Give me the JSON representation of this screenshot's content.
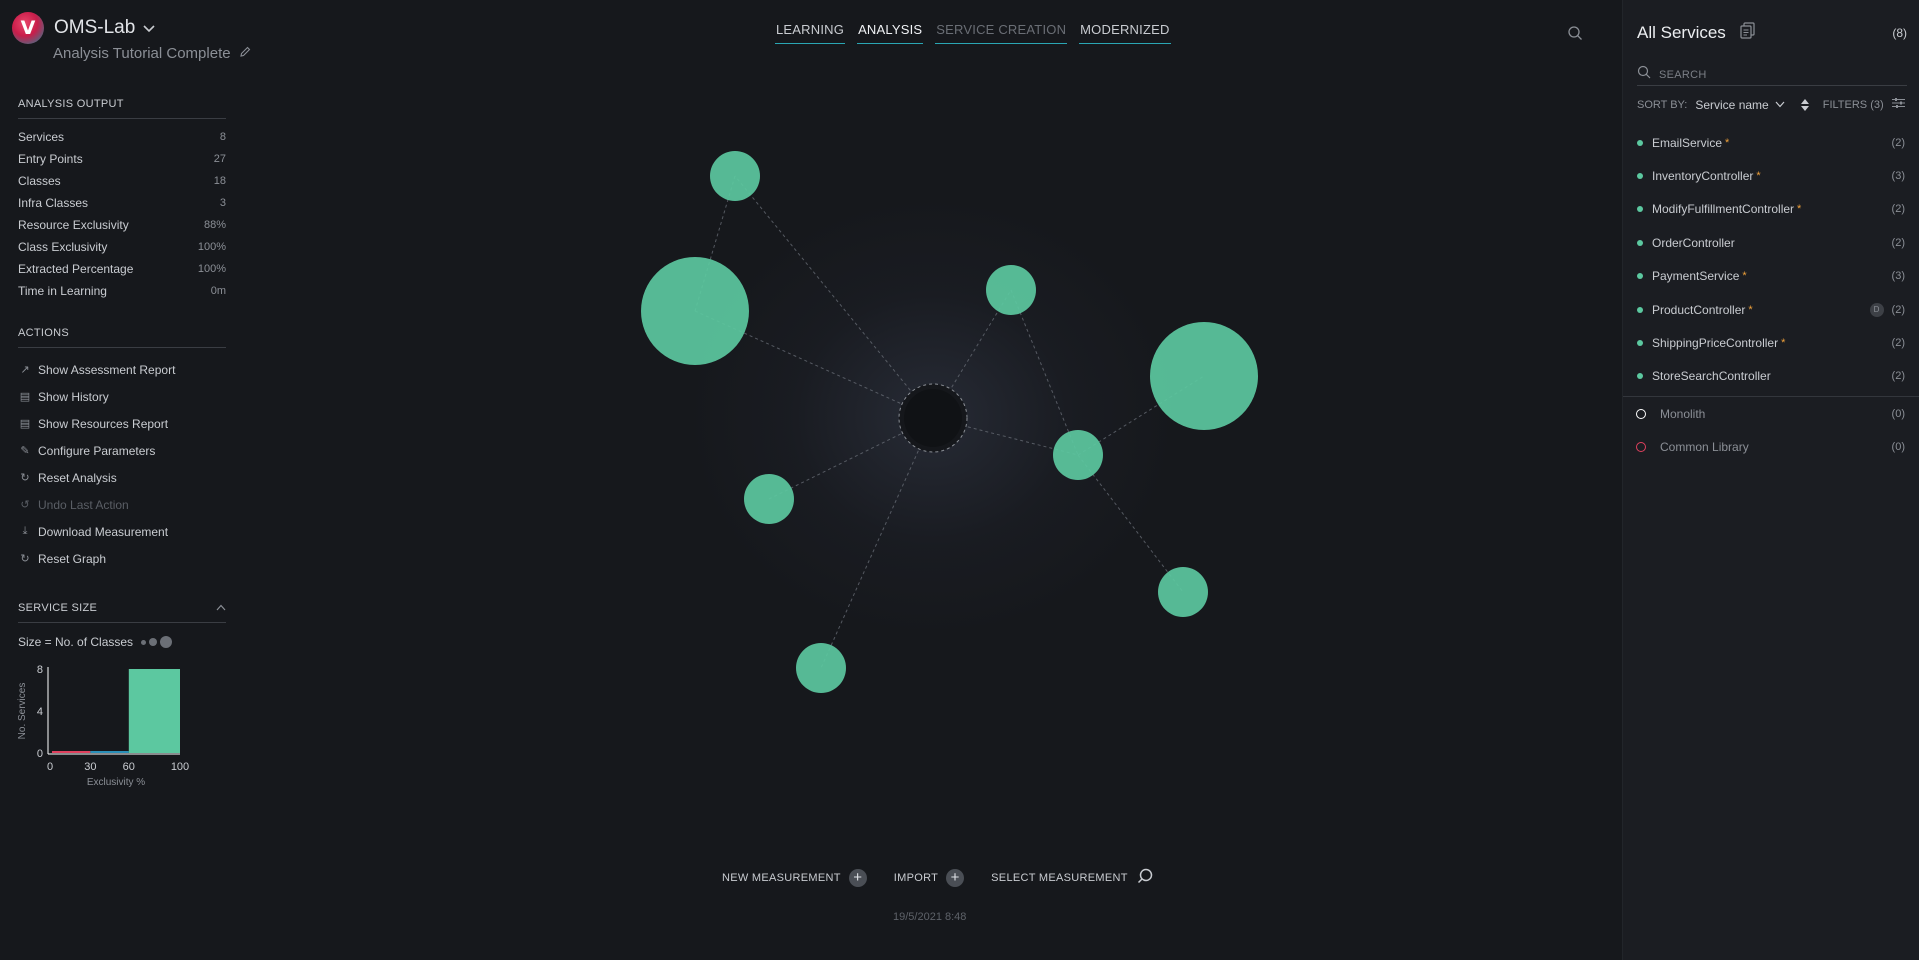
{
  "app": {
    "name": "OMS-Lab",
    "subtitle": "Analysis Tutorial Complete",
    "logo_letter": "V"
  },
  "nav": {
    "tabs": [
      {
        "label": "LEARNING",
        "state": "normal"
      },
      {
        "label": "ANALYSIS",
        "state": "active"
      },
      {
        "label": "SERVICE CREATION",
        "state": "dim"
      },
      {
        "label": "MODERNIZED",
        "state": "normal"
      }
    ]
  },
  "analysis_output": {
    "title": "ANALYSIS OUTPUT",
    "rows": [
      {
        "label": "Services",
        "value": "8"
      },
      {
        "label": "Entry Points",
        "value": "27"
      },
      {
        "label": "Classes",
        "value": "18"
      },
      {
        "label": "Infra Classes",
        "value": "3"
      },
      {
        "label": "Resource Exclusivity",
        "value": "88%"
      },
      {
        "label": "Class Exclusivity",
        "value": "100%"
      },
      {
        "label": "Extracted Percentage",
        "value": "100%"
      },
      {
        "label": "Time in Learning",
        "value": "0m"
      }
    ]
  },
  "actions": {
    "title": "ACTIONS",
    "items": [
      {
        "label": "Show Assessment Report",
        "icon": "external-link-icon",
        "glyph": "↗",
        "enabled": true
      },
      {
        "label": "Show History",
        "icon": "document-icon",
        "glyph": "▤",
        "enabled": true
      },
      {
        "label": "Show Resources Report",
        "icon": "document-icon",
        "glyph": "▤",
        "enabled": true
      },
      {
        "label": "Configure Parameters",
        "icon": "pencil-icon",
        "glyph": "✎",
        "enabled": true
      },
      {
        "label": "Reset Analysis",
        "icon": "reset-icon",
        "glyph": "↻",
        "enabled": true
      },
      {
        "label": "Undo Last Action",
        "icon": "undo-icon",
        "glyph": "↺",
        "enabled": false
      },
      {
        "label": "Download Measurement",
        "icon": "download-icon",
        "glyph": "⤓",
        "enabled": true
      },
      {
        "label": "Reset Graph",
        "icon": "reset-icon",
        "glyph": "↻",
        "enabled": true
      }
    ]
  },
  "service_size": {
    "title": "SERVICE SIZE",
    "legend_label": "Size = No. of Classes"
  },
  "chart_data": {
    "type": "bar",
    "xlabel": "Exclusivity %",
    "ylabel": "No. Services",
    "xticks": [
      "0",
      "30",
      "60",
      "100"
    ],
    "yticks": [
      "0",
      "4",
      "8"
    ],
    "ylim": [
      0,
      8
    ],
    "bins": [
      {
        "range": [
          0,
          30
        ],
        "value": 0,
        "color": "#e0405e"
      },
      {
        "range": [
          30,
          60
        ],
        "value": 0,
        "color": "#2a8fb8"
      },
      {
        "range": [
          60,
          100
        ],
        "value": 8,
        "color": "#5cc8a0"
      }
    ]
  },
  "graph": {
    "node_color": "#5cc8a0",
    "center_color": "#15171b"
  },
  "bottom": {
    "new_measurement": "NEW MEASUREMENT",
    "import": "IMPORT",
    "select_measurement": "SELECT MEASUREMENT",
    "timestamp": "19/5/2021 8:48"
  },
  "right_panel": {
    "title": "All Services",
    "count": "(8)",
    "search_placeholder": "SEARCH",
    "sort_label": "SORT BY:",
    "sort_value": "Service name",
    "filters_label": "FILTERS (3)",
    "services": [
      {
        "name": "EmailService",
        "star": "*",
        "count": "(2)",
        "badge": ""
      },
      {
        "name": "InventoryController",
        "star": "*",
        "count": "(3)",
        "badge": ""
      },
      {
        "name": "ModifyFulfillmentController",
        "star": "*",
        "count": "(2)",
        "badge": ""
      },
      {
        "name": "OrderController",
        "star": "",
        "count": "(2)",
        "badge": ""
      },
      {
        "name": "PaymentService",
        "star": "*",
        "count": "(3)",
        "badge": ""
      },
      {
        "name": "ProductController",
        "star": "*",
        "count": "(2)",
        "badge": "D"
      },
      {
        "name": "ShippingPriceController",
        "star": "*",
        "count": "(2)",
        "badge": ""
      },
      {
        "name": "StoreSearchController",
        "star": "",
        "count": "(2)",
        "badge": ""
      }
    ],
    "special": [
      {
        "name": "Monolith",
        "count": "(0)",
        "ring_color": "#ffffff"
      },
      {
        "name": "Common Library",
        "count": "(0)",
        "ring_color": "#e0405e"
      }
    ]
  }
}
